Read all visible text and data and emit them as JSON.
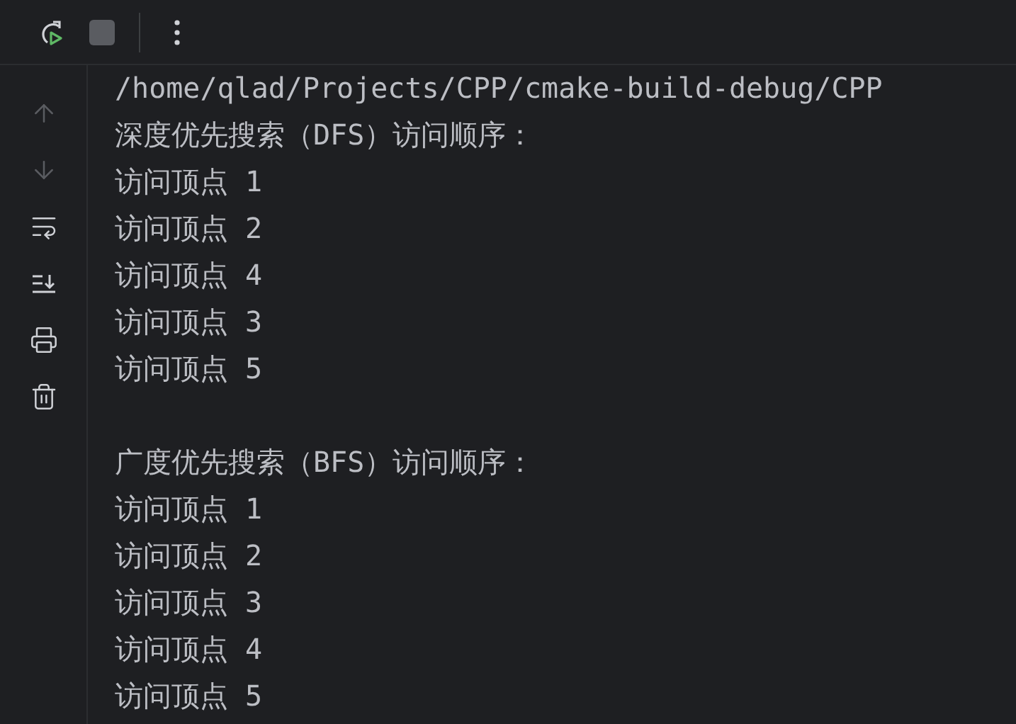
{
  "toolbar": [
    {
      "kind": "rerun",
      "disabled": false
    },
    {
      "kind": "stop",
      "disabled": true
    },
    {
      "kind": "more",
      "disabled": false
    }
  ],
  "gutter": [
    {
      "kind": "up",
      "disabled": true
    },
    {
      "kind": "down",
      "disabled": true
    },
    {
      "kind": "wrap",
      "disabled": false
    },
    {
      "kind": "scroll-end",
      "disabled": false
    },
    {
      "kind": "print",
      "disabled": false
    },
    {
      "kind": "trash",
      "disabled": false
    }
  ],
  "console": [
    {
      "kind": "text",
      "text": "/home/qlad/Projects/CPP/cmake-build-debug/CPP"
    },
    {
      "kind": "text",
      "text": "深度优先搜索（DFS）访问顺序："
    },
    {
      "kind": "text",
      "text": "访问顶点 1"
    },
    {
      "kind": "text",
      "text": "访问顶点 2"
    },
    {
      "kind": "text",
      "text": "访问顶点 4"
    },
    {
      "kind": "text",
      "text": "访问顶点 3"
    },
    {
      "kind": "text",
      "text": "访问顶点 5"
    },
    {
      "kind": "blank"
    },
    {
      "kind": "text",
      "text": "广度优先搜索（BFS）访问顺序："
    },
    {
      "kind": "text",
      "text": "访问顶点 1"
    },
    {
      "kind": "text",
      "text": "访问顶点 2"
    },
    {
      "kind": "text",
      "text": "访问顶点 3"
    },
    {
      "kind": "text",
      "text": "访问顶点 4"
    },
    {
      "kind": "text",
      "text": "访问顶点 5"
    }
  ]
}
